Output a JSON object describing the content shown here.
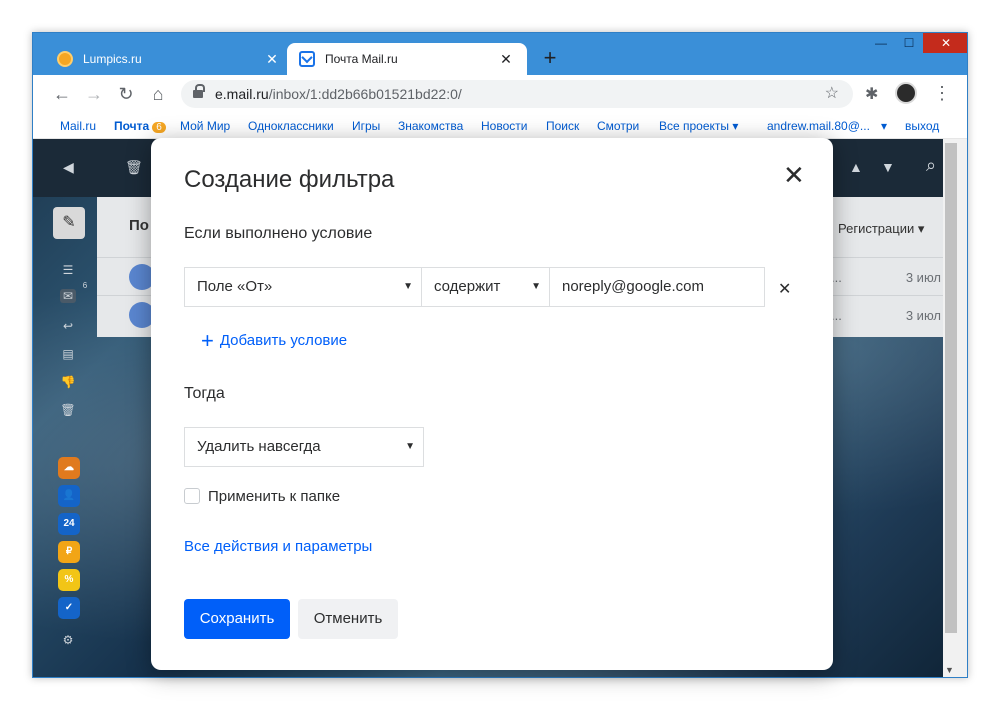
{
  "browser": {
    "tabs": [
      {
        "title": "Lumpics.ru",
        "close": "✕"
      },
      {
        "title": "Почта Mail.ru",
        "close": "✕"
      }
    ],
    "new_tab": "+",
    "window_buttons": {
      "minimize": "—",
      "maximize": "☐",
      "close": "✕"
    },
    "url_host": "e.mail.ru",
    "url_path": "/inbox/1:dd2b66b01521bd22:0/",
    "nav": {
      "back": "←",
      "forward": "→",
      "reload": "↻",
      "home": "⌂",
      "star": "☆",
      "extensions": "✱",
      "menu": "⋮"
    }
  },
  "portal": {
    "links": [
      "Mail.ru",
      "Почта",
      "Мой Мир",
      "Одноклассники",
      "Игры",
      "Знакомства",
      "Новости",
      "Поиск",
      "Смотри",
      "Все проекты ▾"
    ],
    "mail_badge": "6",
    "user": "andrew.mail.80@...",
    "user_caret": "▾",
    "logout": "выход"
  },
  "mail": {
    "folder_header": "По",
    "filter_label": "Регистрации",
    "unread_count": "6",
    "calendar_day": "24",
    "rows": [
      {
        "dots": "...",
        "date": "3 июл"
      },
      {
        "dots": "...",
        "date": "3 июл"
      }
    ]
  },
  "dialog": {
    "title": "Создание фильтра",
    "close": "✕",
    "condition_label": "Если выполнено условие",
    "field_select": "Поле «От»",
    "op_select": "содержит",
    "value_input": "noreply@google.com",
    "remove_condition": "✕",
    "add_condition": "Добавить условие",
    "then_label": "Тогда",
    "action_select": "Удалить навсегда",
    "apply_folder": "Применить к папке",
    "apply_folder_checked": false,
    "all_actions": "Все действия и параметры",
    "save": "Сохранить",
    "cancel": "Отменить"
  },
  "colors": {
    "accent": "#005ff9",
    "chrome_frame": "#3a8fd8",
    "close_red": "#c42b1c"
  }
}
